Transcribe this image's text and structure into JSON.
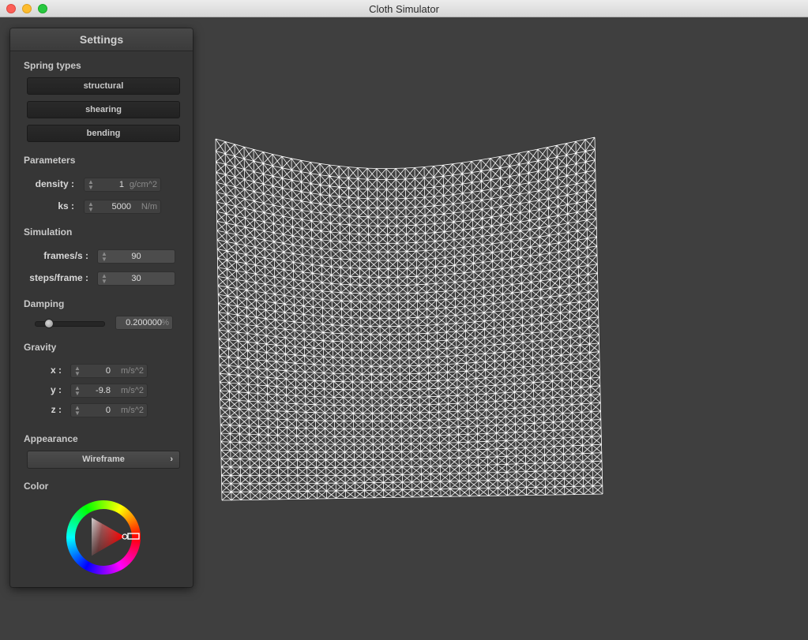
{
  "window": {
    "title": "Cloth Simulator"
  },
  "panel": {
    "title": "Settings",
    "spring_types": {
      "heading": "Spring types",
      "buttons": [
        "structural",
        "shearing",
        "bending"
      ]
    },
    "parameters": {
      "heading": "Parameters",
      "density": {
        "label": "density :",
        "value": "1",
        "unit": "g/cm^2"
      },
      "ks": {
        "label": "ks :",
        "value": "5000",
        "unit": "N/m"
      }
    },
    "simulation": {
      "heading": "Simulation",
      "fps": {
        "label": "frames/s :",
        "value": "90"
      },
      "steps": {
        "label": "steps/frame :",
        "value": "30"
      }
    },
    "damping": {
      "heading": "Damping",
      "slider_fraction": 0.2,
      "value": "0.200000",
      "unit": "%"
    },
    "gravity": {
      "heading": "Gravity",
      "x": {
        "label": "x :",
        "value": "0",
        "unit": "m/s^2"
      },
      "y": {
        "label": "y :",
        "value": "-9.8",
        "unit": "m/s^2"
      },
      "z": {
        "label": "z :",
        "value": "0",
        "unit": "m/s^2"
      }
    },
    "appearance": {
      "heading": "Appearance",
      "selected": "Wireframe"
    },
    "color": {
      "heading": "Color",
      "selected_hex": "#ff0000"
    }
  },
  "viewport": {
    "render_mode": "wireframe",
    "mesh_color": "#ffffff",
    "background": "#3f3f3f"
  }
}
